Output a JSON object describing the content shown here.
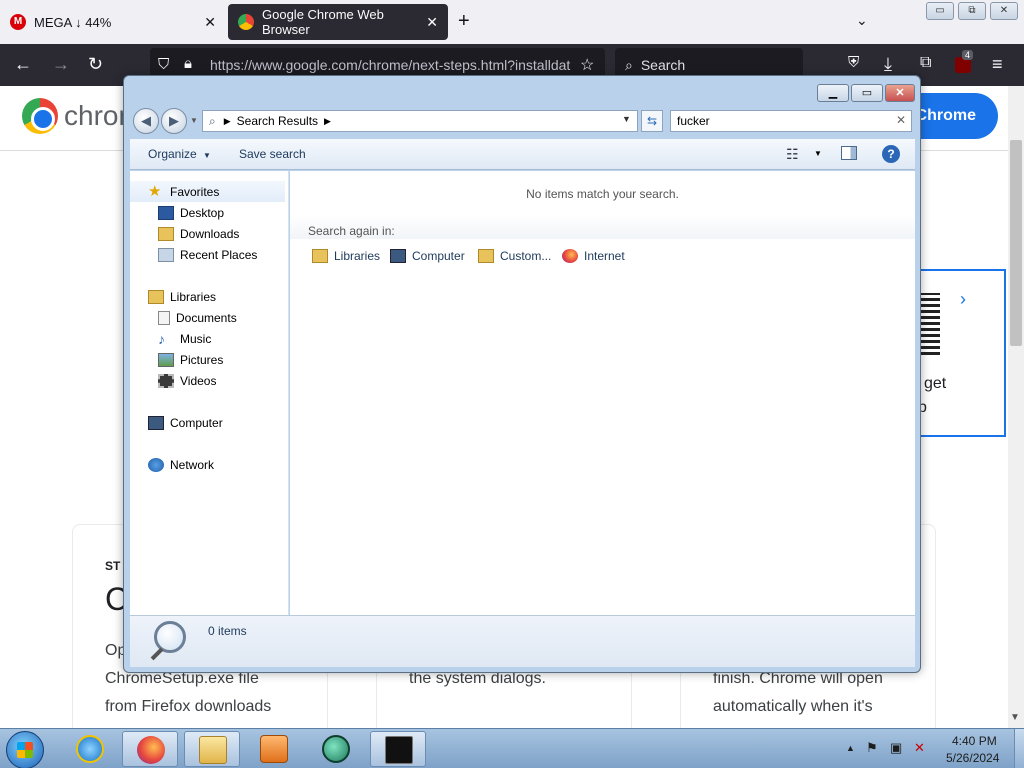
{
  "firefox": {
    "tabs": [
      {
        "label": "MEGA ↓ 44%",
        "icon": "mega-icon",
        "color": "#d90007"
      },
      {
        "label": "Google Chrome Web Browser",
        "icon": "chrome-icon",
        "active": true
      }
    ],
    "new_tab": "+",
    "tab_list": "⌄",
    "window_buttons": {
      "minimize": "▭",
      "restore": "⧉",
      "close": "✕"
    },
    "url": "https://www.google.com/chrome/next-steps.html?installdat",
    "search_placeholder": "Search",
    "extension_badge": "4"
  },
  "webpage": {
    "brand": "chrome",
    "download_button": "Chrome",
    "qr_text_line1": "get",
    "qr_text_line2": "p",
    "card1_lines": [
      "ST",
      "C",
      "Op",
      "ChromeSetup.exe file",
      "from Firefox downloads"
    ],
    "card2_lines": [
      "the system dialogs."
    ],
    "card3_lines": [
      "finish. Chrome will open",
      "automatically when it's"
    ]
  },
  "explorer": {
    "breadcrumb": "Search Results",
    "search_query": "fucker",
    "commands": {
      "organize": "Organize",
      "save_search": "Save search"
    },
    "nav": {
      "favorites": {
        "label": "Favorites",
        "items": [
          "Desktop",
          "Downloads",
          "Recent Places"
        ]
      },
      "libraries": {
        "label": "Libraries",
        "items": [
          "Documents",
          "Music",
          "Pictures",
          "Videos"
        ]
      },
      "computer": "Computer",
      "network": "Network"
    },
    "no_items_message": "No items match your search.",
    "search_again_label": "Search again in:",
    "search_again_items": [
      "Libraries",
      "Computer",
      "Custom...",
      "Internet"
    ],
    "item_count": "0 items"
  },
  "taskbar": {
    "time": "4:40 PM",
    "date": "5/26/2024"
  },
  "colors": {
    "chrome_blue": "#1a73e8",
    "explorer_frame": "#b9d1ea",
    "firefox_dark": "#2b2a33"
  }
}
